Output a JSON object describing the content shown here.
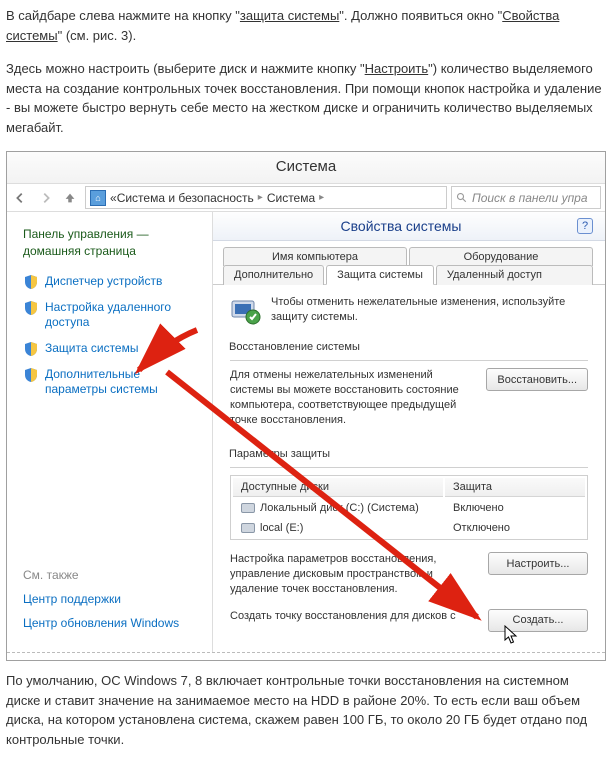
{
  "article": {
    "p1_a": "В сайдбаре слева нажмите на кнопку \"",
    "p1_link": "защита системы",
    "p1_b": "\". Должно появиться окно \"",
    "p1_link2": "Свойства системы",
    "p1_c": "\" (см. рис. 3).",
    "p2_a": "Здесь можно настроить (выберите диск и нажмите кнопку \"",
    "p2_link": "Настроить",
    "p2_b": "\") количество выделяемого места на создание контрольных точек восстановления. При помощи кнопок настройка и удаление - вы можете быстро вернуть себе место на жестком диске и ограничить количество выделяемых мегабайт.",
    "p3": "По умолчанию, ОС Windows 7, 8 включает контрольные точки восстановления на системном диске и ставит значение на занимаемое место на HDD в районе 20%. То есть если ваш объем диска, на котором установлена система, скажем равен 100 ГБ, то около 20 ГБ будет отдано под контрольные точки."
  },
  "window": {
    "title": "Система",
    "crumb_a": "Система и безопасность",
    "crumb_b": "Система",
    "search_placeholder": "Поиск в панели упра"
  },
  "sidebar": {
    "home": "Панель управления — домашняя страница",
    "l0": "Диспетчер устройств",
    "l1": "Настройка удаленного доступа",
    "l2": "Защита системы",
    "l3": "Дополнительные параметры системы",
    "see_also": "См. также",
    "s0": "Центр поддержки",
    "s1": "Центр обновления Windows"
  },
  "dialog": {
    "title": "Свойства системы",
    "tabs": {
      "t0": "Имя компьютера",
      "t1": "Оборудование",
      "t2": "Дополнительно",
      "t3": "Защита системы",
      "t4": "Удаленный доступ"
    },
    "info": "Чтобы отменить нежелательные изменения, используйте защиту системы.",
    "grp_restore": "Восстановление системы",
    "restore_desc": "Для отмены нежелательных изменений системы вы можете восстановить состояние компьютера, соответствующее предыдущей точке восстановления.",
    "btn_restore": "Восстановить...",
    "grp_params": "Параметры защиты",
    "col_drives": "Доступные диски",
    "col_prot": "Защита",
    "drives": [
      {
        "name": "Локальный диск (C:) (Система)",
        "prot": "Включено"
      },
      {
        "name": "local (E:)",
        "prot": "Отключено"
      }
    ],
    "cfg_desc": "Настройка параметров восстановления, управление дисковым пространством и удаление точек восстановления.",
    "btn_cfg": "Настроить...",
    "create_desc": "Создать точку восстановления для дисков с",
    "btn_create": "Создать..."
  }
}
